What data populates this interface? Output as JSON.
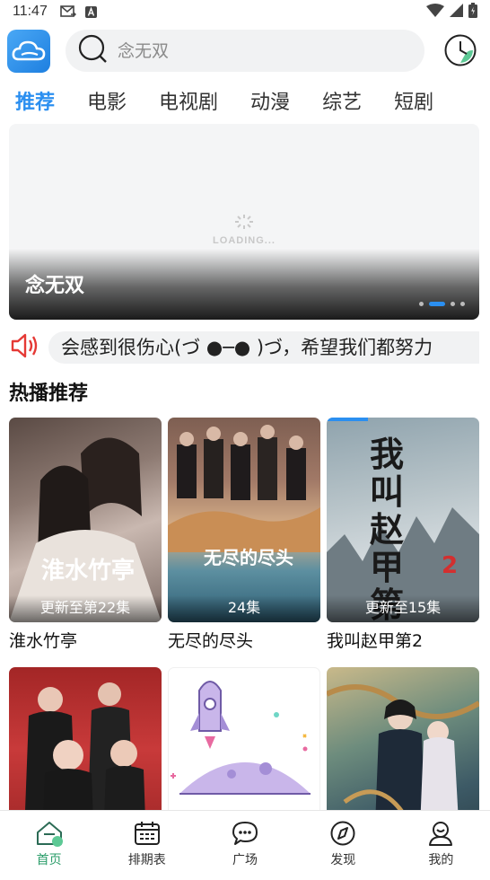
{
  "status_bar": {
    "time": "11:47"
  },
  "search": {
    "placeholder": "念无双"
  },
  "tabs": [
    {
      "label": "推荐",
      "active": true
    },
    {
      "label": "电影"
    },
    {
      "label": "电视剧"
    },
    {
      "label": "动漫"
    },
    {
      "label": "综艺"
    },
    {
      "label": "短剧"
    }
  ],
  "banner": {
    "loading_text": "LOADING...",
    "title": "念无双",
    "dot_count": 4,
    "active_dot": 1
  },
  "notice": {
    "text": "会感到很伤心(づ ●─● )づ，希望我们都努力"
  },
  "hot": {
    "section_title": "热播推荐",
    "items": [
      {
        "title": "淮水竹亭",
        "badge": "更新至第22集"
      },
      {
        "title": "无尽的尽头",
        "badge": "24集"
      },
      {
        "title": "我叫赵甲第2",
        "badge": "更新至15集"
      },
      {
        "title": "",
        "badge": ""
      },
      {
        "title": "",
        "badge": ""
      },
      {
        "title": "",
        "badge": ""
      }
    ]
  },
  "poster_art": {
    "p1": "淮水竹亭",
    "p2": "无尽的尽头",
    "p3": "我叫赵甲第"
  },
  "bottom_nav": [
    {
      "label": "首页",
      "icon": "home-icon",
      "active": true
    },
    {
      "label": "排期表",
      "icon": "calendar-icon"
    },
    {
      "label": "广场",
      "icon": "chat-bubble-icon"
    },
    {
      "label": "发现",
      "icon": "compass-icon"
    },
    {
      "label": "我的",
      "icon": "user-icon"
    }
  ],
  "colors": {
    "accent": "#2b8ff0",
    "nav_active": "#2b9d6a"
  }
}
